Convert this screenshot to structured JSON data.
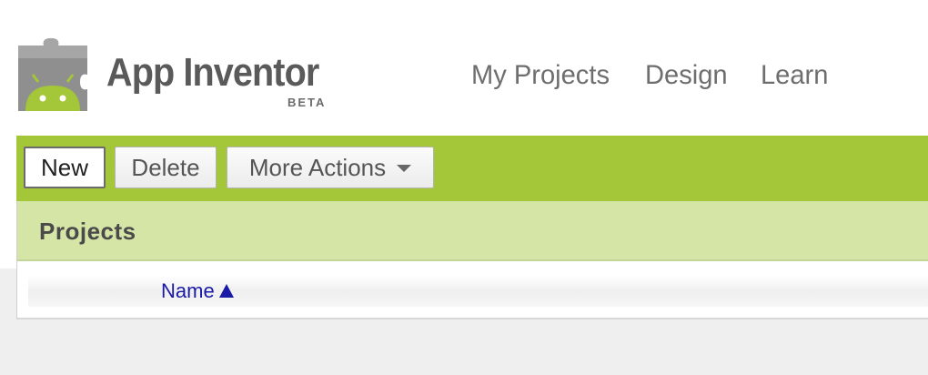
{
  "header": {
    "app_title": "App Inventor",
    "beta_label": "BETA",
    "logo_icon": "app-inventor-android-puzzle-icon",
    "nav": [
      {
        "label": "My Projects"
      },
      {
        "label": "Design"
      },
      {
        "label": "Learn"
      }
    ]
  },
  "toolbar": {
    "new_label": "New",
    "delete_label": "Delete",
    "more_actions_label": "More Actions",
    "more_actions_icon": "chevron-down-icon"
  },
  "projects": {
    "title": "Projects",
    "columns": [
      {
        "label": "Name",
        "sort": "ascending",
        "sort_icon": "sort-ascending-icon"
      }
    ],
    "rows": []
  },
  "colors": {
    "toolbar_green": "#a4c639",
    "header_band": "#d4e5a6",
    "link_blue": "#1a1aa6",
    "android_green": "#a4c639",
    "puzzle_grey": "#8f8f8f"
  }
}
